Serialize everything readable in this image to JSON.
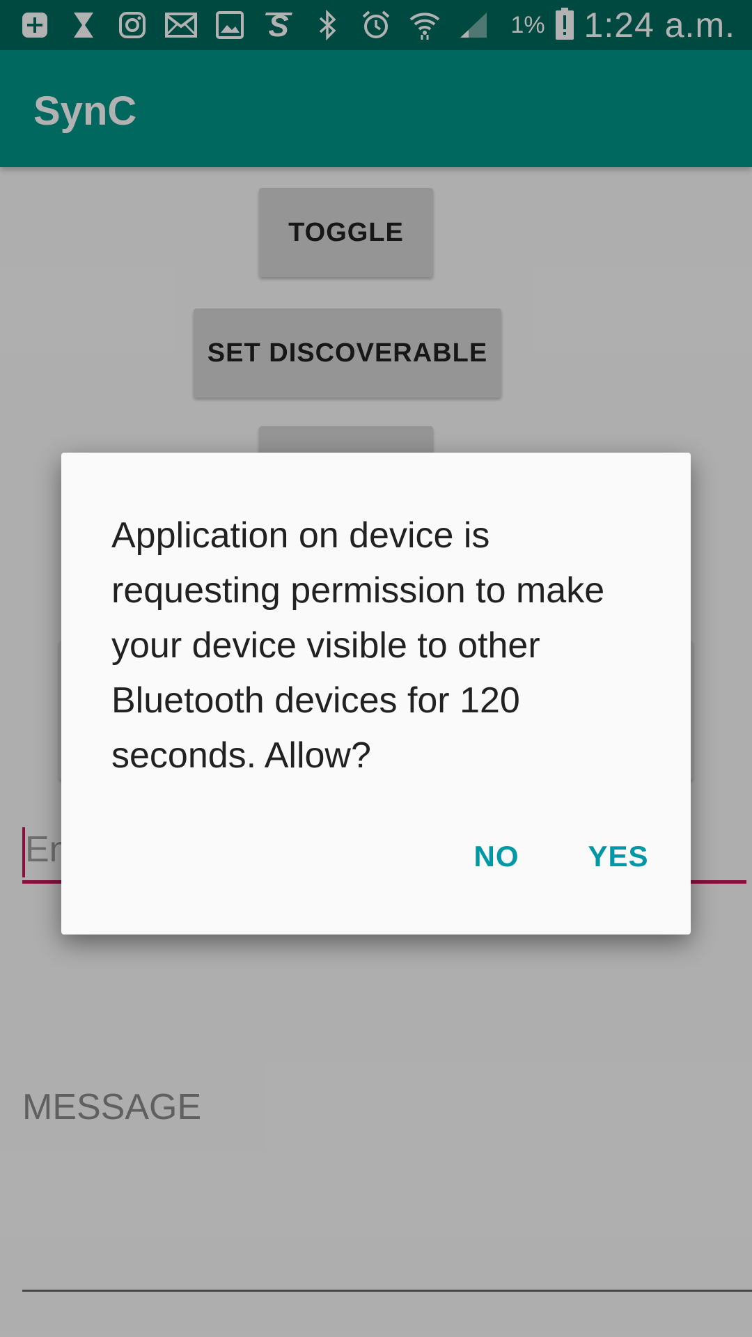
{
  "status_bar": {
    "icons": [
      "add-box-icon",
      "hourglass-icon",
      "instagram-icon",
      "mail-icon",
      "image-icon",
      "s-app-icon",
      "bluetooth-icon",
      "alarm-icon",
      "wifi-icon",
      "signal-icon",
      "battery-alert-icon"
    ],
    "battery_percent": "1%",
    "time": "1:24 a.m."
  },
  "app_bar": {
    "title": "SynC"
  },
  "main": {
    "toggle_label": "TOGGLE",
    "set_discoverable_label": "SET DISCOVERABLE",
    "edit_hint": "En",
    "message_label": "MESSAGE"
  },
  "dialog": {
    "message": "Application on device is requesting permission to make your device visible to other Bluetooth devices for 120 seconds. Allow?",
    "no_label": "NO",
    "yes_label": "YES"
  },
  "colors": {
    "status_bar": "#00695c",
    "app_bar": "#009688",
    "accent": "#c2185b",
    "dialog_button": "#0097a7"
  }
}
